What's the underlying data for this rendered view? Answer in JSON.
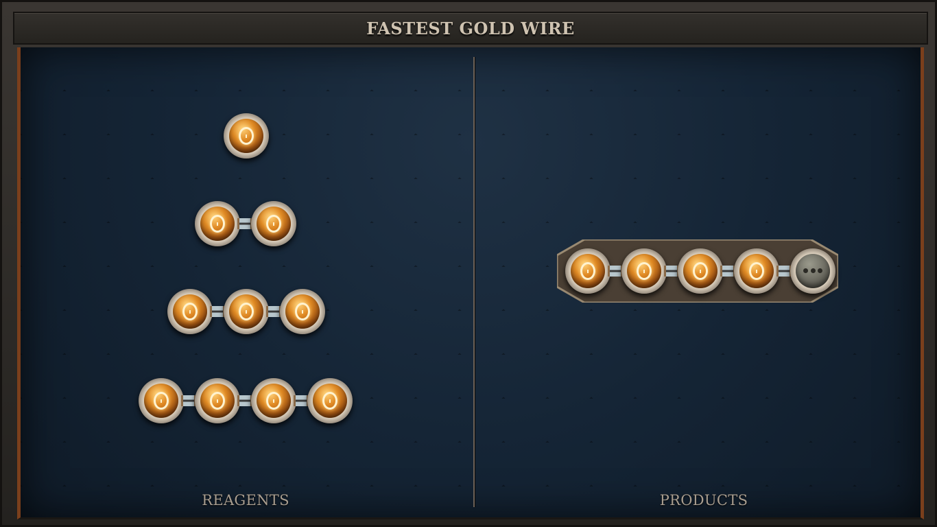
{
  "title": "FASTEST GOLD WIRE",
  "sections": {
    "reagents_label": "REAGENTS",
    "products_label": "PRODUCTS"
  },
  "reagents": [
    {
      "atoms": 1,
      "element": "gold"
    },
    {
      "atoms": 2,
      "element": "gold"
    },
    {
      "atoms": 3,
      "element": "gold"
    },
    {
      "atoms": 4,
      "element": "gold"
    }
  ],
  "product": {
    "atoms": [
      "gold",
      "gold",
      "gold",
      "gold",
      "repeat"
    ]
  },
  "colors": {
    "board": "#142232",
    "border_accent": "#7a3f1c",
    "gold_atom": "#e08a24",
    "label_text": "#a99e90"
  }
}
